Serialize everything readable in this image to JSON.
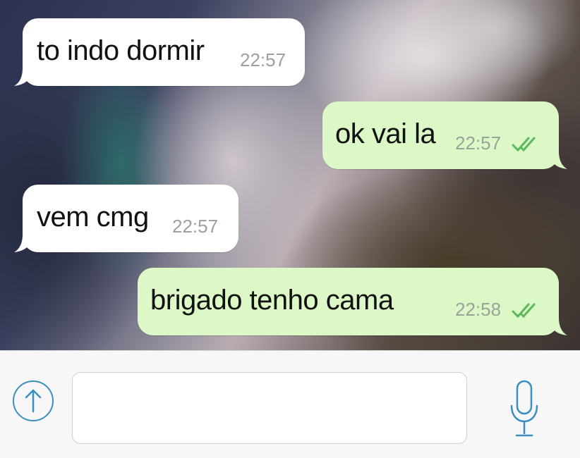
{
  "messages": [
    {
      "direction": "incoming",
      "text": "to indo dormir",
      "time": "22:57"
    },
    {
      "direction": "outgoing",
      "text": "ok vai la",
      "time": "22:57",
      "status": "read-double-check"
    },
    {
      "direction": "incoming",
      "text": "vem cmg",
      "time": "22:57"
    },
    {
      "direction": "outgoing",
      "text": "brigado tenho cama",
      "time": "22:58",
      "status": "read-double-check"
    }
  ],
  "input_bar": {
    "send_icon": "up-arrow-circle-icon",
    "message_value": "",
    "mic_icon": "microphone-icon"
  },
  "colors": {
    "incoming_bubble": "#ffffff",
    "outgoing_bubble": "#dcf8c6",
    "time_text": "#9aa39a",
    "read_ticks": "#5cb85c",
    "accent_blue": "#3a8fc0"
  }
}
